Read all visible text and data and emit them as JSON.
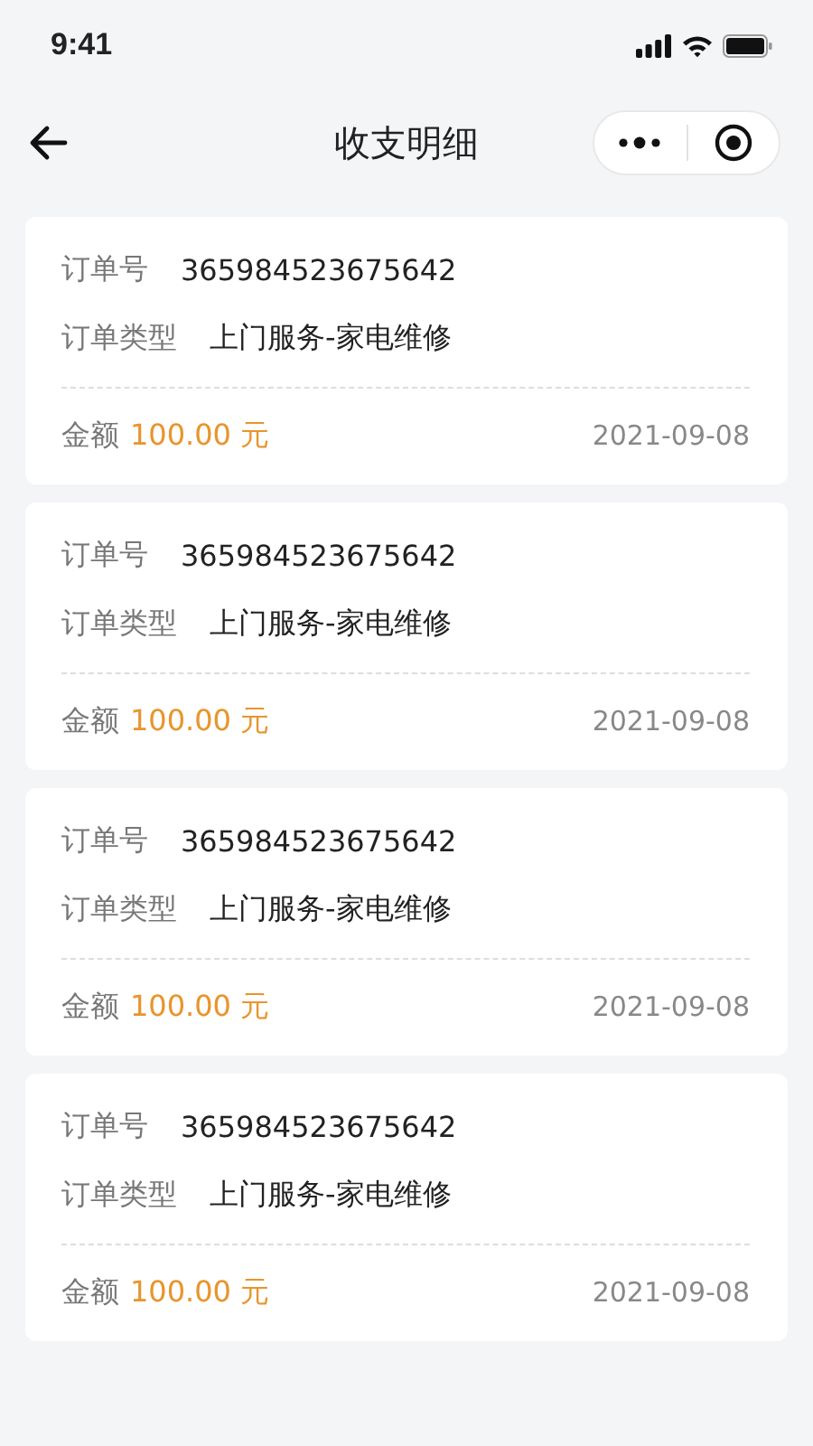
{
  "status_bar": {
    "time": "9:41"
  },
  "nav": {
    "title": "收支明细"
  },
  "records": [
    {
      "order_label": "订单号",
      "order_no": "365984523675642",
      "type_label": "订单类型",
      "type": "上门服务-家电维修",
      "amount_label": "金额",
      "amount": "100.00 元",
      "date": "2021-09-08"
    },
    {
      "order_label": "订单号",
      "order_no": "365984523675642",
      "type_label": "订单类型",
      "type": "上门服务-家电维修",
      "amount_label": "金额",
      "amount": "100.00 元",
      "date": "2021-09-08"
    },
    {
      "order_label": "订单号",
      "order_no": "365984523675642",
      "type_label": "订单类型",
      "type": "上门服务-家电维修",
      "amount_label": "金额",
      "amount": "100.00 元",
      "date": "2021-09-08"
    },
    {
      "order_label": "订单号",
      "order_no": "365984523675642",
      "type_label": "订单类型",
      "type": "上门服务-家电维修",
      "amount_label": "金额",
      "amount": "100.00 元",
      "date": "2021-09-08"
    }
  ]
}
